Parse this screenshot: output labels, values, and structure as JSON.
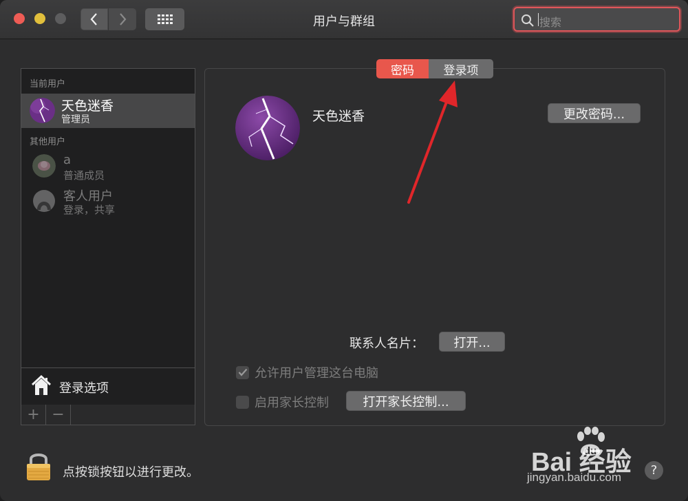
{
  "window": {
    "title": "用户与群组",
    "search_placeholder": "搜索"
  },
  "tabs": [
    {
      "label": "密码",
      "selected": true
    },
    {
      "label": "登录项",
      "selected": false
    }
  ],
  "sidebar": {
    "current_header": "当前用户",
    "current_user": {
      "name": "天色迷香",
      "role": "管理员"
    },
    "others_header": "其他用户",
    "others": [
      {
        "name": "a",
        "role": "普通成员"
      },
      {
        "name": "客人用户",
        "role": "登录，共享"
      }
    ],
    "login_options_label": "登录选项",
    "add_label": "+",
    "remove_label": "−"
  },
  "detail": {
    "username": "天色迷香",
    "change_password_button": "更改密码...",
    "contact_card_label": "联系人名片：",
    "open_button": "打开...",
    "allow_admin_label": "允许用户管理这台电脑",
    "allow_admin_checked": true,
    "parental_label": "启用家长控制",
    "parental_checked": false,
    "open_parental_button": "打开家长控制..."
  },
  "footer": {
    "lock_text": "点按锁按钮以进行更改。",
    "help_label": "?"
  },
  "watermark": {
    "brand": "Bai  经验",
    "url": "jingyan.baidu.com"
  },
  "colors": {
    "accent_red": "#e8574c",
    "annotation_arrow": "#e0262a"
  }
}
